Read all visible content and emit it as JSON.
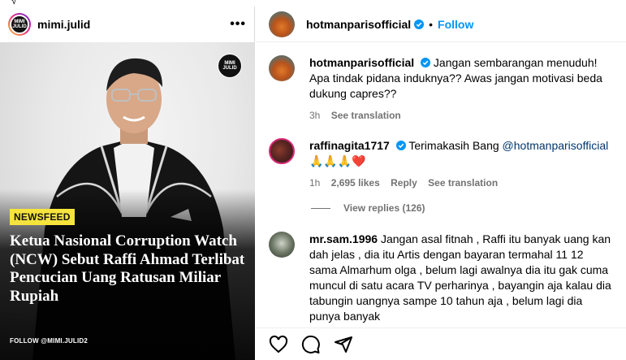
{
  "post": {
    "username": "mimi.julid",
    "avatar_text": "MIMI JULID",
    "more_icon": "more-horizontal-icon",
    "logo_text": "MIMI JULID",
    "tag": "NEWSFEED",
    "headline": "Ketua Nasional Corruption Watch (NCW) Sebut Raffi Ahmad Terlibat Pencucian Uang Ratusan Miliar Rupiah",
    "follow_text": "FOLLOW @MIMI.JULID2"
  },
  "header": {
    "username": "hotmanparisofficial",
    "separator": "•",
    "follow_label": "Follow"
  },
  "comments": [
    {
      "username": "hotmanparisofficial",
      "verified": true,
      "text": "Jangan sembarangan menuduh! Apa tindak pidana induknya?? Awas jangan motivasi beda dukung capres??",
      "time": "3h",
      "translate": "See translation"
    },
    {
      "username": "raffinagita1717",
      "verified": true,
      "text_before": "Terimakasih Bang ",
      "mention": "@hotmanparisofficial",
      "emoji": " 🙏🙏🙏❤️",
      "time": "1h",
      "likes": "2,695 likes",
      "reply": "Reply",
      "translate": "See translation",
      "view_replies": "View replies (126)"
    },
    {
      "username": "mr.sam.1996",
      "verified": false,
      "text": "Jangan asal fitnah , Raffi itu banyak uang kan dah jelas , dia itu Artis dengan bayaran termahal 11 12 sama Almarhum olga , belum lagi awalnya dia itu gak cuma muncul di satu acara TV perharinya , bayangin aja kalau dia tabungin uangnya sampe 10 tahun aja , belum lagi dia punya banyak"
    }
  ],
  "actions": {
    "like_icon": "heart-icon",
    "comment_icon": "comment-icon",
    "share_icon": "share-icon"
  },
  "colors": {
    "accent": "#0095f6",
    "tag_bg": "#f6e43c",
    "mention": "#00376b",
    "muted": "#737373"
  }
}
